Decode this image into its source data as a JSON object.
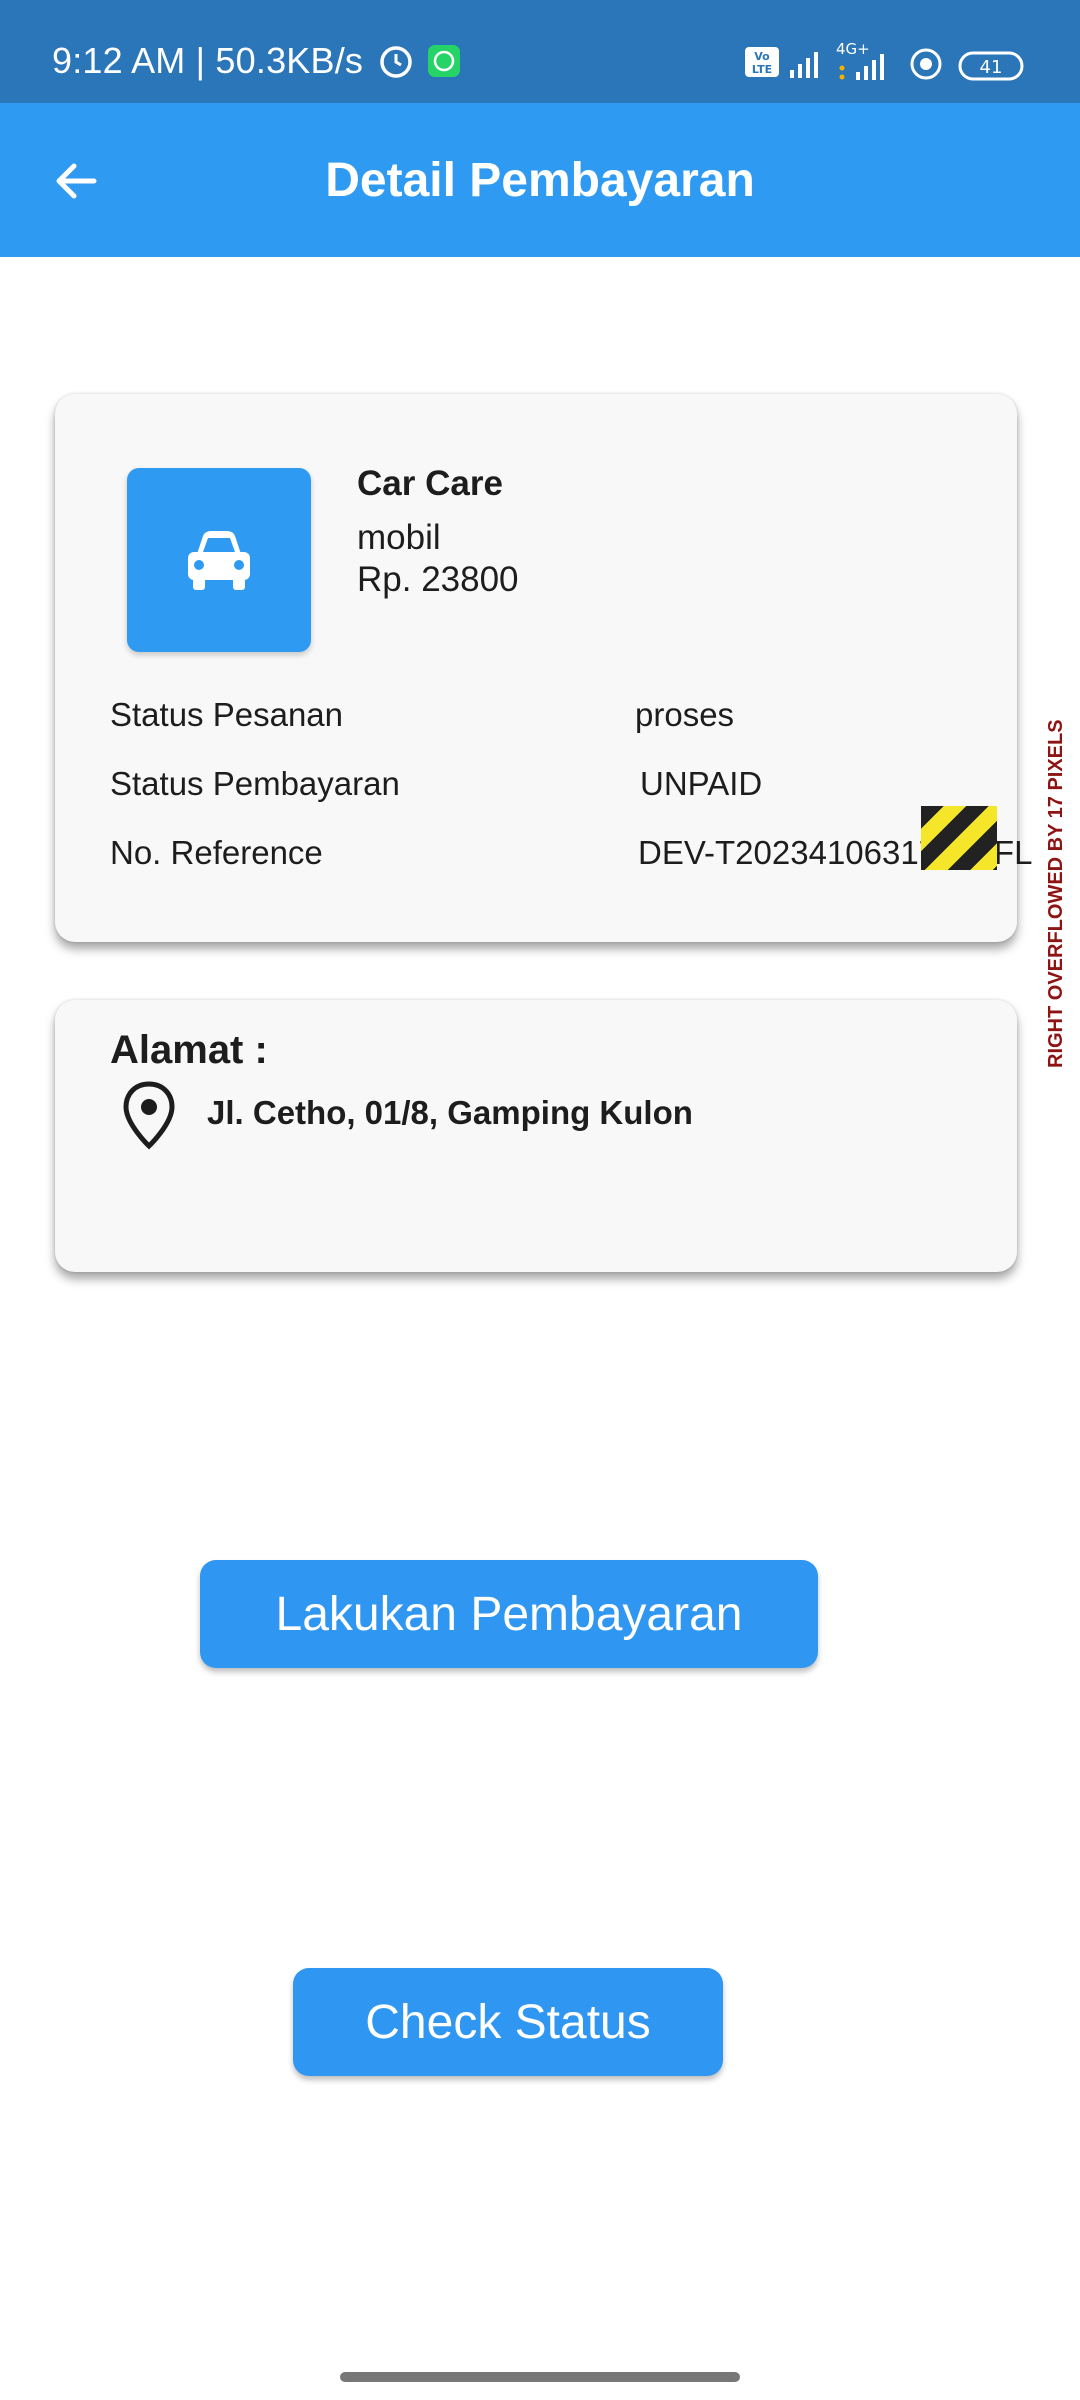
{
  "status_bar": {
    "time_speed": "9:12 AM | 50.3KB/s",
    "network_label": "4G+",
    "volte_label": "Vo LTE",
    "battery_level": "41",
    "icons": [
      "alarm-icon",
      "whatsapp-icon",
      "volte-icon",
      "signal-icon",
      "signal-4g-icon",
      "focus-icon",
      "battery-icon"
    ]
  },
  "app_bar": {
    "title": "Detail Pembayaran",
    "back_icon": "arrow-back-icon"
  },
  "service": {
    "icon": "car-icon",
    "name": "Car Care",
    "type": "mobil",
    "price": "Rp.  23800"
  },
  "details": [
    {
      "label": "Status Pesanan",
      "value": "proses"
    },
    {
      "label": "Status Pembayaran",
      "value": "UNPAID"
    },
    {
      "label": "No. Reference",
      "value": "DEV-T202341063177VJFL"
    }
  ],
  "debug_overflow": "RIGHT OVERFLOWED BY 17 PIXELS",
  "address": {
    "title": "Alamat :",
    "icon": "location-pin-icon",
    "text": "Jl. Cetho, 01/8, Gamping Kulon"
  },
  "actions": {
    "pay_label": "Lakukan Pembayaran",
    "check_label": "Check Status"
  },
  "colors": {
    "status_bar": "#2a76b8",
    "app_bar": "#2f9af2",
    "button": "#2f96f1",
    "card": "#f8f8f8"
  }
}
